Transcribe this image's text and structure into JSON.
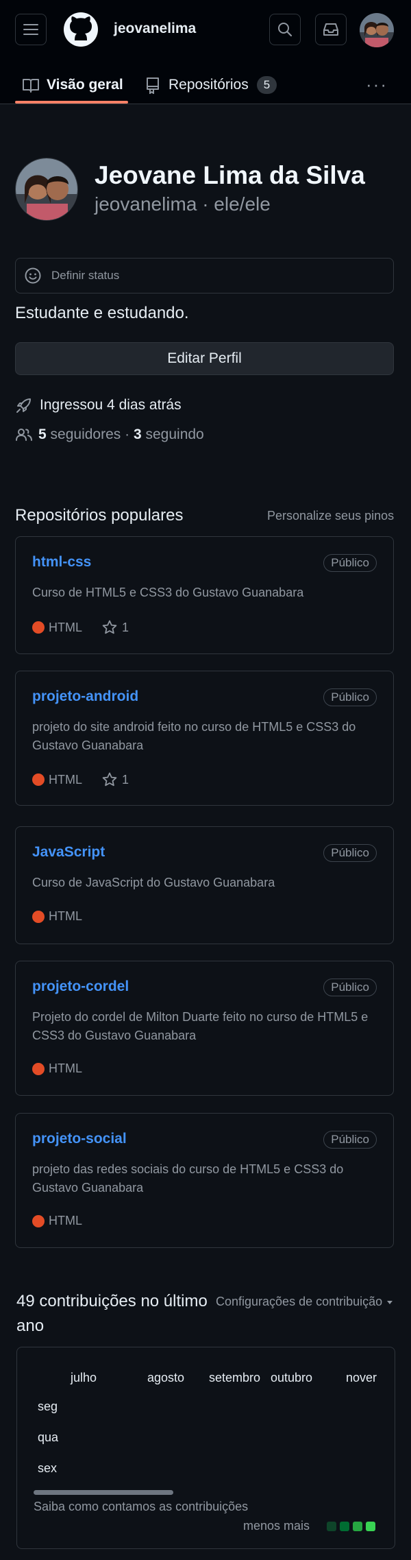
{
  "header": {
    "username": "jeovanelima",
    "tabs": [
      {
        "label": "Visão geral"
      },
      {
        "label": "Repositórios",
        "count": "5"
      }
    ],
    "more": "···"
  },
  "profile": {
    "full_name": "Jeovane Lima da Silva",
    "handle": "jeovanelima · ele/ele",
    "status_label": "Definir status",
    "bio": "Estudante e estudando.",
    "edit_label": "Editar Perfil",
    "joined": "Ingressou 4 dias atrás",
    "followers_count": "5",
    "followers_label": "seguidores",
    "sep": "·",
    "following_count": "3",
    "following_label": "seguindo"
  },
  "popular": {
    "title": "Repositórios populares",
    "customize": "Personalize seus pinos",
    "repos": [
      {
        "name": "html-css",
        "visibility": "Público",
        "description": "Curso de HTML5 e CSS3 do Gustavo Guanabara",
        "language": "HTML",
        "stars": "1"
      },
      {
        "name": "projeto-android",
        "visibility": "Público",
        "description": "projeto do site android feito no curso de HTML5 e CSS3 do Gustavo Guanabara",
        "language": "HTML",
        "stars": "1"
      },
      {
        "name": "JavaScript",
        "visibility": "Público",
        "description": "Curso de JavaScript do Gustavo Guanabara",
        "language": "HTML"
      },
      {
        "name": "projeto-cordel",
        "visibility": "Público",
        "description": "Projeto do cordel de Milton Duarte feito no curso de HTML5 e CSS3 do Gustavo Guanabara",
        "language": "HTML"
      },
      {
        "name": "projeto-social",
        "visibility": "Público",
        "description": "projeto das redes sociais do curso de HTML5 e CSS3 do Gustavo Guanabara",
        "language": "HTML"
      }
    ]
  },
  "contributions": {
    "title": "49 contribuições no último ano",
    "settings": "Configurações de contribuição",
    "months": [
      "julho",
      "agosto",
      "setembro",
      "outubro",
      "nover"
    ],
    "days": [
      "seg",
      "qua",
      "sex"
    ],
    "learn": "Saiba como contamos as contribuições",
    "legend": "menos mais",
    "legend_colors": [
      "#0e4429",
      "#006d32",
      "#26a641",
      "#39d353"
    ]
  },
  "colors": {
    "accent": "#f78166",
    "link": "#4493f8",
    "html_lang": "#e34c26"
  }
}
